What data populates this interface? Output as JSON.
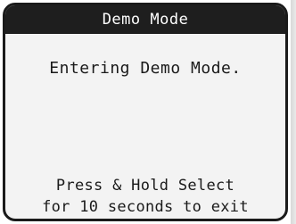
{
  "header": {
    "title": "Demo Mode"
  },
  "main": {
    "message": "Entering Demo Mode.",
    "instructions": {
      "line1": "Press & Hold Select",
      "line2": "for 10 seconds to exit"
    }
  },
  "colors": {
    "title_bar_background": "#1e1e1e",
    "title_text": "#ffffff",
    "screen_background": "#f3f3f3",
    "text": "#1a1a1a"
  }
}
